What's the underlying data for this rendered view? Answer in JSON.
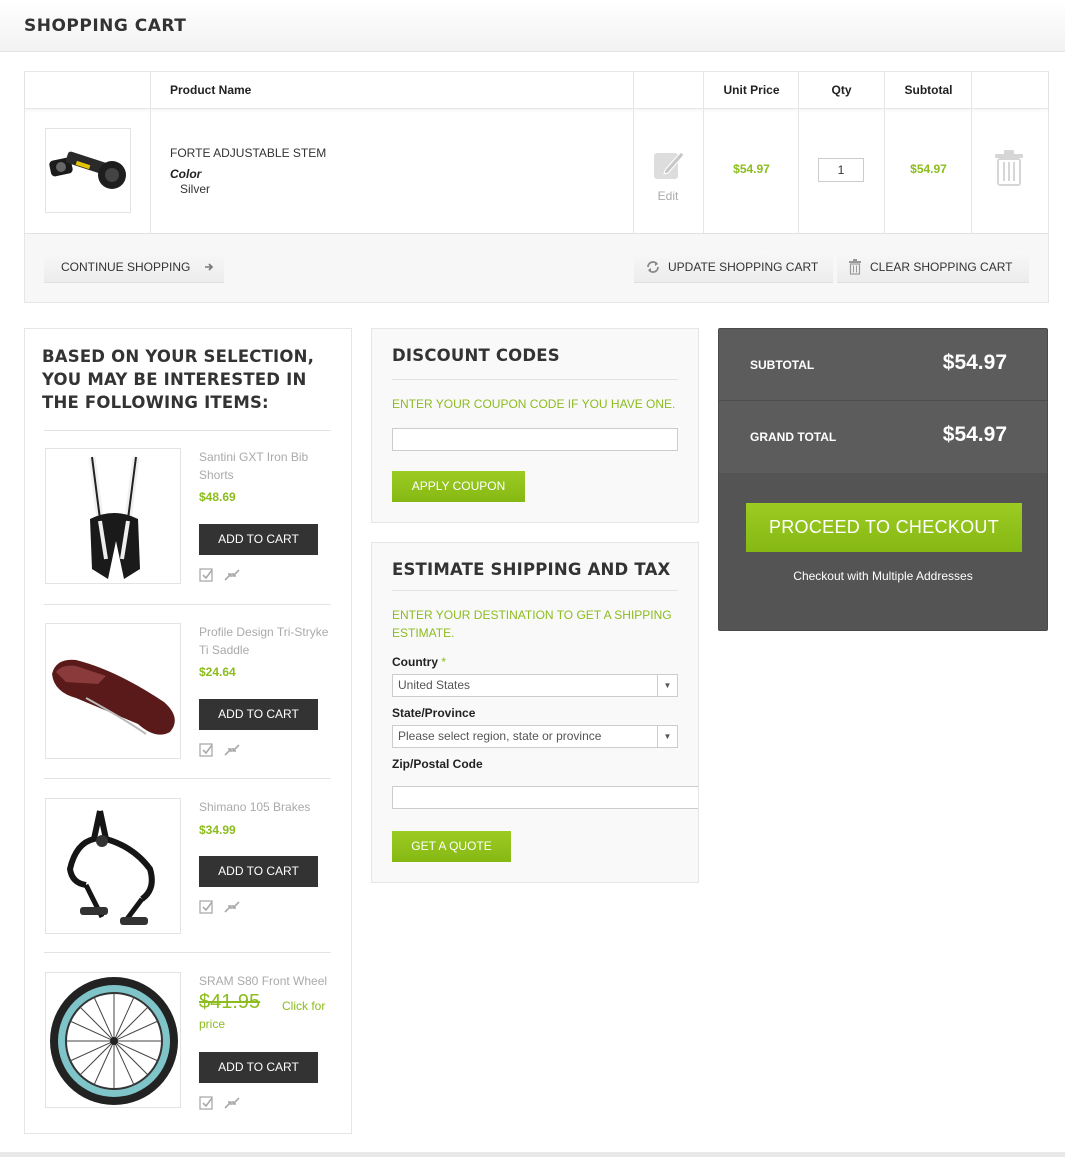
{
  "page": {
    "title": "SHOPPING CART"
  },
  "cart": {
    "columns": {
      "product_name": "Product Name",
      "unit_price": "Unit Price",
      "qty": "Qty",
      "subtotal": "Subtotal"
    },
    "items": [
      {
        "name": "FORTE ADJUSTABLE STEM",
        "option_label": "Color",
        "option_value": "Silver",
        "edit_label": "Edit",
        "unit_price": "$54.97",
        "qty": "1",
        "subtotal": "$54.97"
      }
    ],
    "actions": {
      "continue": "CONTINUE SHOPPING",
      "update": "UPDATE SHOPPING CART",
      "clear": "CLEAR SHOPPING CART"
    }
  },
  "crosssell": {
    "title": "BASED ON YOUR SELECTION, YOU MAY BE INTERESTED IN THE FOLLOWING ITEMS:",
    "add_label": "ADD TO CART",
    "items": [
      {
        "name": "Santini GXT Iron Bib Shorts",
        "price": "$48.69"
      },
      {
        "name": "Profile Design Tri-Stryke Ti Saddle",
        "price": "$24.64"
      },
      {
        "name": "Shimano 105 Brakes",
        "price": "$34.99"
      },
      {
        "name": "SRAM S80 Front Wheel",
        "old_price": "$41.95",
        "click_text": "Click for price"
      }
    ]
  },
  "discount": {
    "title": "DISCOUNT CODES",
    "hint": "ENTER YOUR COUPON CODE IF YOU HAVE ONE.",
    "code_value": "",
    "button": "APPLY COUPON"
  },
  "shipping": {
    "title": "ESTIMATE SHIPPING AND TAX",
    "hint": "ENTER YOUR DESTINATION TO GET A SHIPPING ESTIMATE.",
    "country_label": "Country",
    "required_mark": "*",
    "country_value": "United States",
    "state_label": "State/Province",
    "state_value": "Please select region, state or province",
    "zip_label": "Zip/Postal Code",
    "zip_value": "",
    "button": "GET A QUOTE"
  },
  "totals": {
    "subtotal_label": "SUBTOTAL",
    "subtotal_value": "$54.97",
    "grand_label": "GRAND TOTAL",
    "grand_value": "$54.97",
    "checkout": "PROCEED TO CHECKOUT",
    "multi": "Checkout with Multiple Addresses"
  },
  "colors": {
    "accent": "#8cbc1e",
    "dark_button": "#333333",
    "totals_bg": "#545454"
  },
  "icons": [
    "edit-icon",
    "trash-icon",
    "arrow-right-icon",
    "refresh-icon",
    "wishlist-icon",
    "compare-icon"
  ]
}
